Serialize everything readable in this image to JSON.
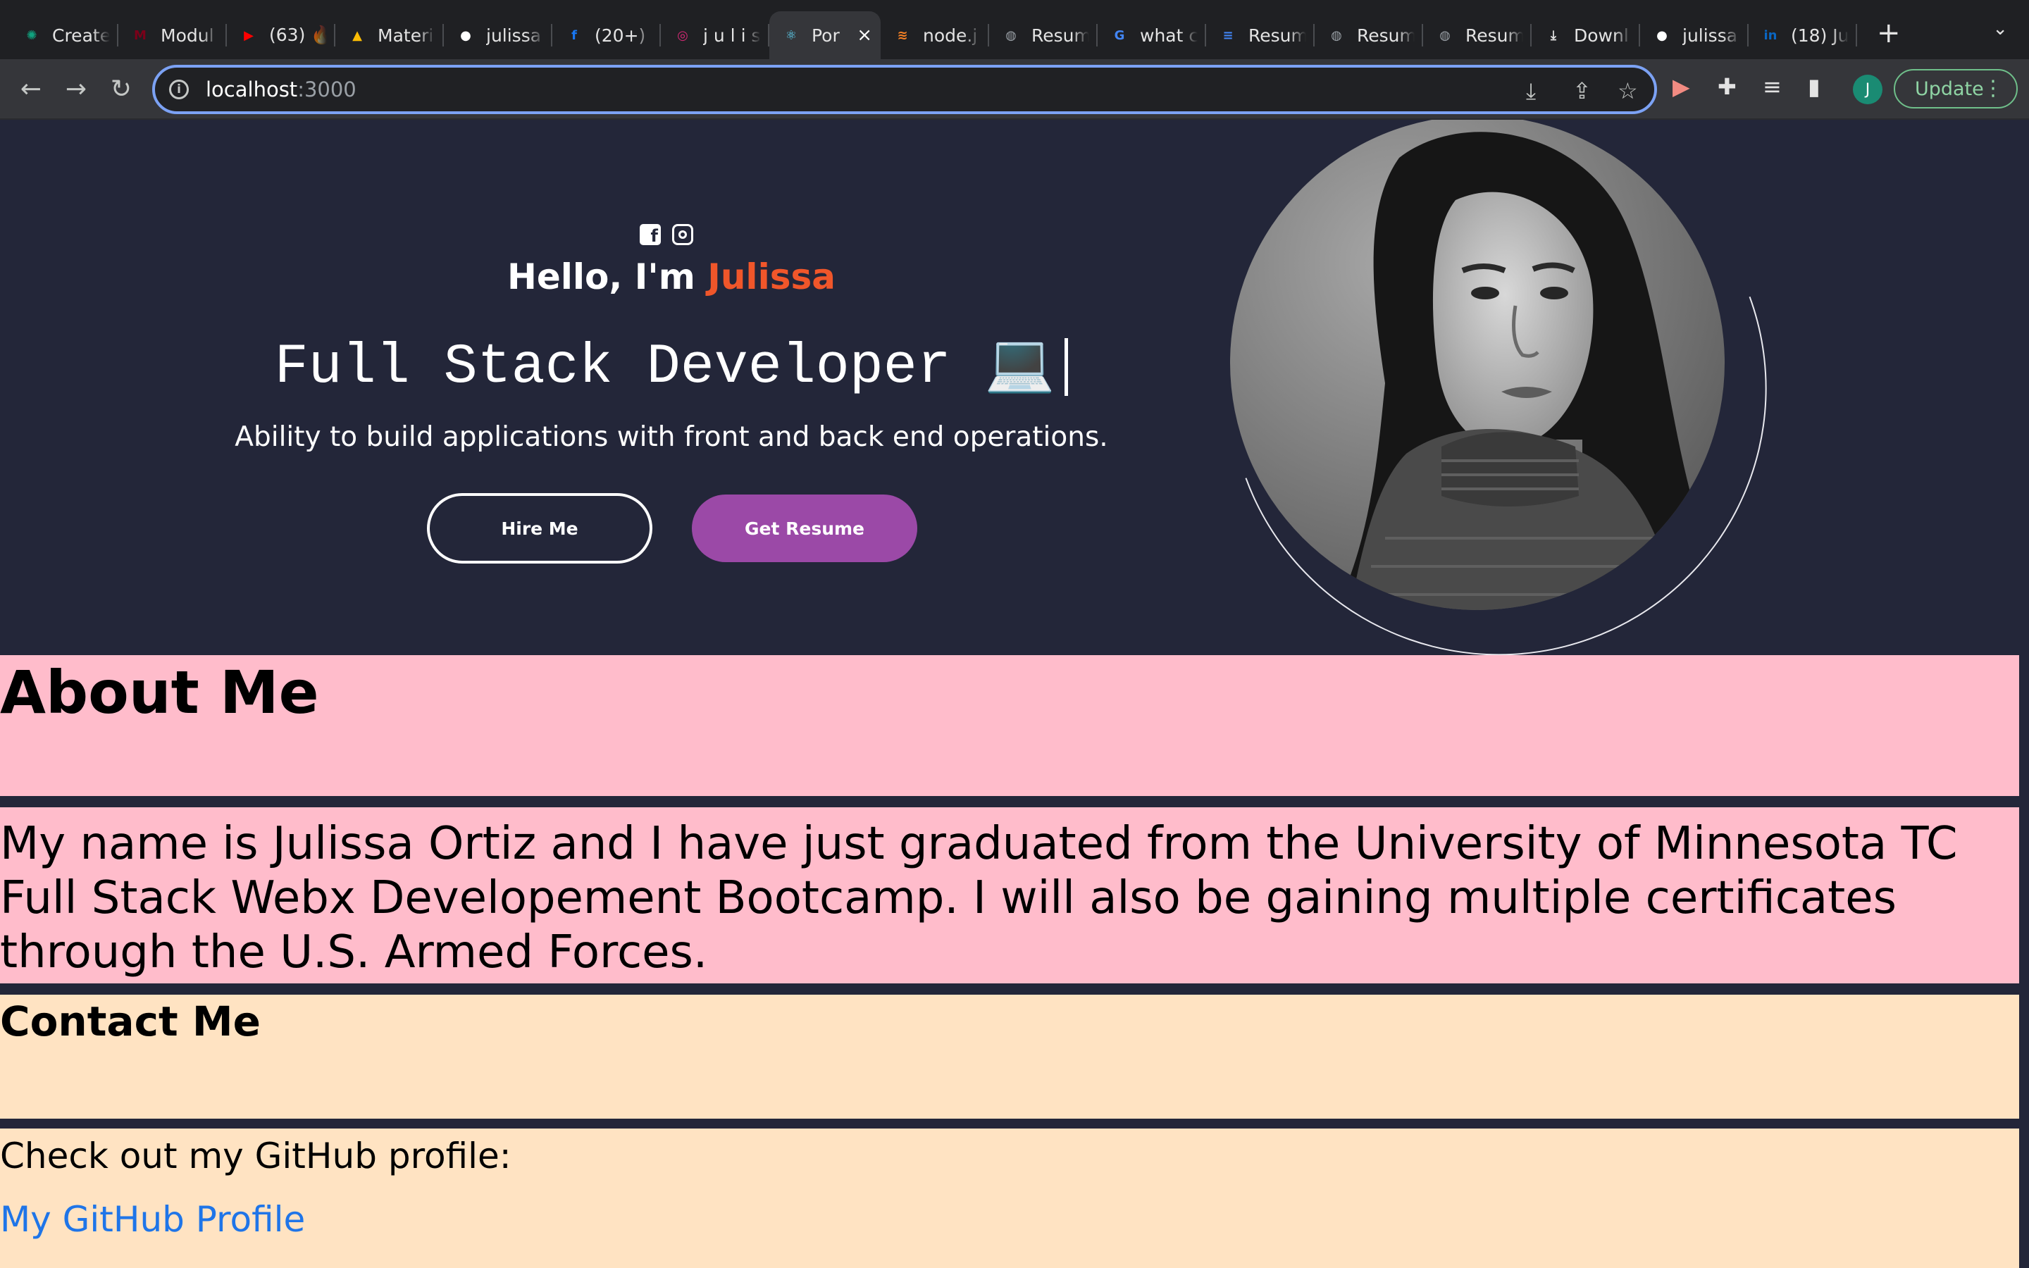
{
  "browser": {
    "tabs": [
      {
        "title": "Create",
        "favicon": "chatgpt-icon",
        "color": "#10a37f"
      },
      {
        "title": "Modul",
        "favicon": "canvas-m-icon",
        "color": "#7a0019"
      },
      {
        "title": "(63) 🔥",
        "favicon": "youtube-icon",
        "color": "#ff0000"
      },
      {
        "title": "Materi",
        "favicon": "google-drive-icon",
        "color": "#fbbc04"
      },
      {
        "title": "julissa",
        "favicon": "github-icon",
        "color": "#ffffff"
      },
      {
        "title": "(20+)",
        "favicon": "facebook-icon",
        "color": "#1877f2"
      },
      {
        "title": "j u l i s",
        "favicon": "instagram-icon",
        "color": "#d62976"
      },
      {
        "title": "Por",
        "favicon": "react-icon",
        "color": "#61dafb",
        "active": true
      },
      {
        "title": "node.j",
        "favicon": "stackoverflow-icon",
        "color": "#f48024"
      },
      {
        "title": "Resum",
        "favicon": "globe-icon",
        "color": "#9aa0a6"
      },
      {
        "title": "what c",
        "favicon": "google-icon",
        "color": "#4285f4"
      },
      {
        "title": "Resum",
        "favicon": "google-docs-icon",
        "color": "#4285f4"
      },
      {
        "title": "Resum",
        "favicon": "globe-icon",
        "color": "#9aa0a6"
      },
      {
        "title": "Resum",
        "favicon": "globe-icon",
        "color": "#9aa0a6"
      },
      {
        "title": "Downl",
        "favicon": "download-icon",
        "color": "#e3e3e3"
      },
      {
        "title": "julissa",
        "favicon": "github-icon",
        "color": "#ffffff"
      },
      {
        "title": "(18) Ju",
        "favicon": "linkedin-icon",
        "color": "#0a66c2"
      }
    ],
    "url_host": "localhost",
    "url_port": ":3000",
    "update_label": "Update",
    "profile_initial": "J"
  },
  "hero": {
    "greeting_prefix": "Hello, I'm ",
    "greeting_name": "Julissa",
    "role": "Full Stack Developer 💻",
    "tagline": "Ability to build applications with front and back end operations.",
    "hire_label": "Hire Me",
    "resume_label": "Get Resume",
    "accent_color": "#f0562a",
    "button_color": "#9b49a7"
  },
  "about": {
    "title": "About Me",
    "text": "My name is Julissa Ortiz and I have just graduated from the University of Minnesota TC Full Stack Webx Developement Bootcamp. I will also be gaining multiple certificates through the U.S. Armed Forces."
  },
  "contact": {
    "title": "Contact Me",
    "github_label": "Check out my GitHub profile:",
    "github_link": "My GitHub Profile"
  }
}
